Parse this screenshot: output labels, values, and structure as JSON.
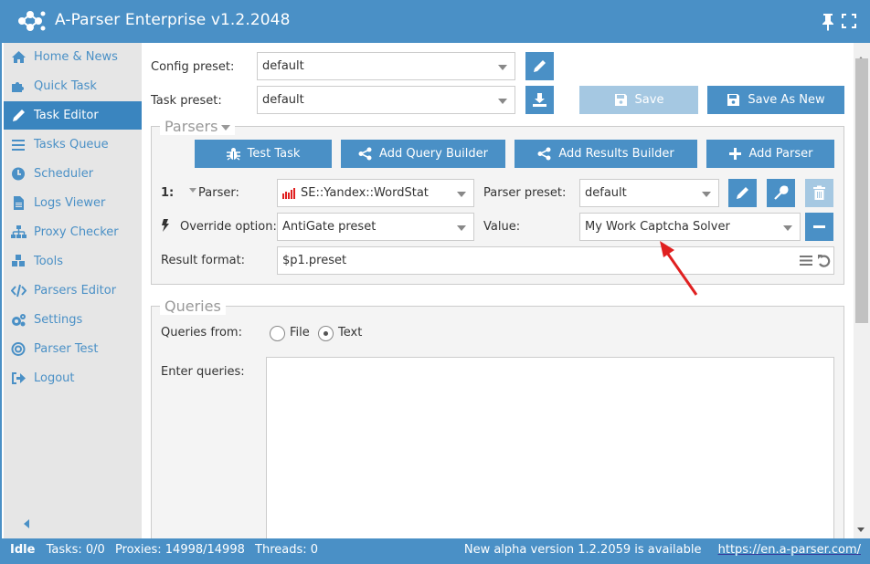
{
  "app": {
    "title": "A-Parser Enterprise v1.2.2048",
    "accent_color": "#4a90c6"
  },
  "titlebar_icons": [
    "pin-icon",
    "fullscreen-icon"
  ],
  "sidebar": {
    "items": [
      {
        "label": "Home & News",
        "icon": "home-icon"
      },
      {
        "label": "Quick Task",
        "icon": "puzzle-icon"
      },
      {
        "label": "Task Editor",
        "icon": "pencil-icon",
        "active": true
      },
      {
        "label": "Tasks Queue",
        "icon": "list-icon"
      },
      {
        "label": "Scheduler",
        "icon": "clock-icon"
      },
      {
        "label": "Logs Viewer",
        "icon": "file-icon"
      },
      {
        "label": "Proxy Checker",
        "icon": "sitemap-icon"
      },
      {
        "label": "Tools",
        "icon": "cubes-icon"
      },
      {
        "label": "Parsers Editor",
        "icon": "code-icon"
      },
      {
        "label": "Settings",
        "icon": "gears-icon"
      },
      {
        "label": "Parser Test",
        "icon": "target-icon"
      },
      {
        "label": "Logout",
        "icon": "sign-out-icon"
      }
    ]
  },
  "top": {
    "config_preset_label": "Config preset:",
    "config_preset_value": "default",
    "task_preset_label": "Task preset:",
    "task_preset_value": "default",
    "save_label": "Save",
    "save_as_new_label": "Save As New"
  },
  "parsers": {
    "legend": "Parsers",
    "buttons": {
      "test_task": "Test Task",
      "add_query_builder": "Add Query Builder",
      "add_results_builder": "Add Results Builder",
      "add_parser": "Add Parser"
    },
    "index": "1:",
    "parser_label": "Parser:",
    "parser_value": "SE::Yandex::WordStat",
    "parser_preset_label": "Parser preset:",
    "parser_preset_value": "default",
    "override_label": "Override option:",
    "override_value": "AntiGate preset",
    "value_label": "Value:",
    "value_value": "My Work Captcha Solver",
    "result_format_label": "Result format:",
    "result_format_value": "$p1.preset"
  },
  "queries": {
    "legend": "Queries",
    "queries_from_label": "Queries from:",
    "options": [
      {
        "label": "File",
        "checked": false
      },
      {
        "label": "Text",
        "checked": true
      }
    ],
    "enter_queries_label": "Enter queries:",
    "queries_text": ""
  },
  "statusbar": {
    "state": "Idle",
    "tasks": "Tasks: 0/0",
    "proxies": "Proxies: 14998/14998",
    "threads": "Threads: 0",
    "update_notice": "New alpha version 1.2.2059 is available",
    "link": "https://en.a-parser.com/"
  },
  "annotation": {
    "arrow_color": "#e02020"
  }
}
